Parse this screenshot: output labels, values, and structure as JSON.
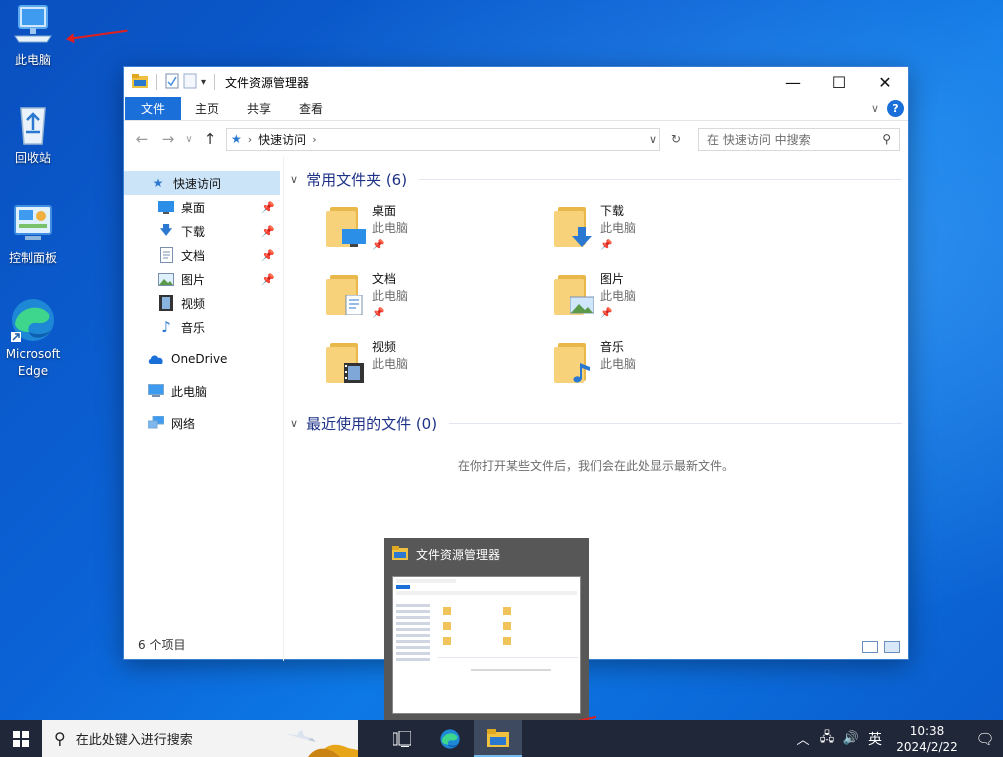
{
  "desktop": {
    "icons": [
      {
        "label": "此电脑",
        "icon": "computer-icon"
      },
      {
        "label": "回收站",
        "icon": "recycle-bin-icon"
      },
      {
        "label": "控制面板",
        "icon": "control-panel-icon"
      },
      {
        "label": "Microsoft Edge",
        "icon": "edge-icon"
      }
    ]
  },
  "window": {
    "title": "文件资源管理器",
    "controls": {
      "minimize": "—",
      "maximize": "☐",
      "close": "✕"
    },
    "ribbon": {
      "tabs": [
        "文件",
        "主页",
        "共享",
        "查看"
      ],
      "help": "?"
    },
    "address": {
      "crumbs": [
        "快速访问"
      ],
      "search_placeholder": "在 快速访问 中搜索"
    },
    "nav": {
      "quick_access": "快速访问",
      "pinned": [
        {
          "label": "桌面",
          "icon": "desktop-icon",
          "pinned": true
        },
        {
          "label": "下载",
          "icon": "download-icon",
          "pinned": true
        },
        {
          "label": "文档",
          "icon": "document-icon",
          "pinned": true
        },
        {
          "label": "图片",
          "icon": "picture-icon",
          "pinned": true
        },
        {
          "label": "视频",
          "icon": "video-icon",
          "pinned": false
        },
        {
          "label": "音乐",
          "icon": "music-icon",
          "pinned": false
        }
      ],
      "onedrive": "OneDrive",
      "this_pc": "此电脑",
      "network": "网络"
    },
    "content": {
      "frequent_header": "常用文件夹 (6)",
      "folders": [
        {
          "name": "桌面",
          "location": "此电脑",
          "pinned": true,
          "badge": "desktop"
        },
        {
          "name": "下载",
          "location": "此电脑",
          "pinned": true,
          "badge": "download"
        },
        {
          "name": "文档",
          "location": "此电脑",
          "pinned": true,
          "badge": "document"
        },
        {
          "name": "图片",
          "location": "此电脑",
          "pinned": true,
          "badge": "picture"
        },
        {
          "name": "视频",
          "location": "此电脑",
          "pinned": false,
          "badge": "video"
        },
        {
          "name": "音乐",
          "location": "此电脑",
          "pinned": false,
          "badge": "music"
        }
      ],
      "recent_header": "最近使用的文件 (0)",
      "recent_empty": "在你打开某些文件后，我们会在此处显示最新文件。"
    },
    "status": "6 个项目"
  },
  "thumbnail": {
    "title": "文件资源管理器"
  },
  "taskbar": {
    "search_placeholder": "在此处键入进行搜索",
    "ime": "英",
    "time": "10:38",
    "date": "2024/2/22"
  },
  "colors": {
    "accent": "#1a6fd8",
    "annotation_arrow": "#e0201c",
    "taskbar": "#1f2738"
  }
}
